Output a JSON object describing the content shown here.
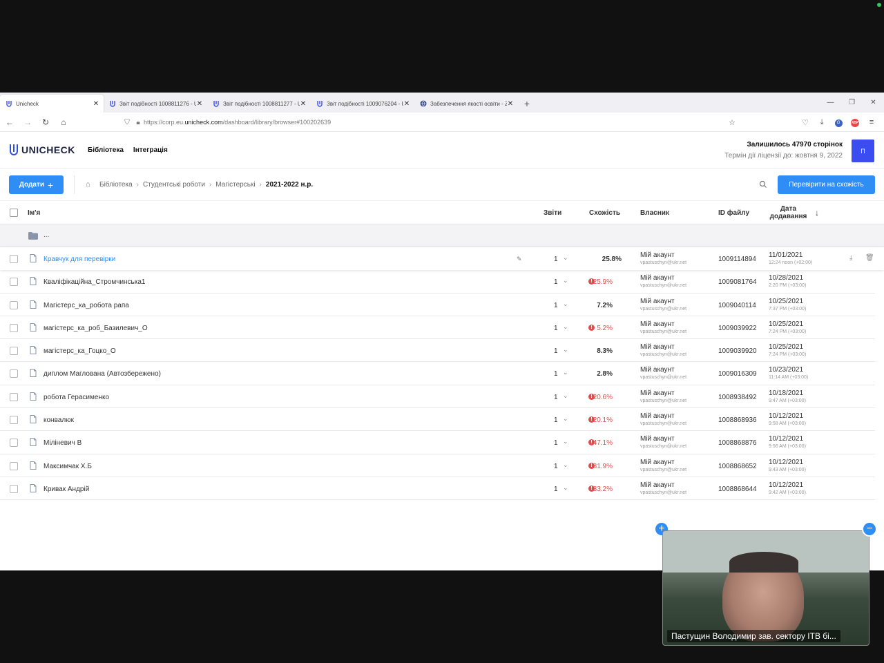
{
  "browser": {
    "tabs": [
      {
        "label": "Unicheck",
        "active": true
      },
      {
        "label": "Звіт подібності 1008811276 - Ur",
        "active": false
      },
      {
        "label": "Звіт подібності 1008811277 - Ur",
        "active": false
      },
      {
        "label": "Звіт подібності 1009076204 - Ur",
        "active": false
      },
      {
        "label": "Забезпечення якості освіти - Z",
        "active": false
      }
    ],
    "url_prefix": "https://corp.eu.",
    "url_domain": "unicheck.com",
    "url_path": "/dashboard/library/browser#100202639"
  },
  "header": {
    "logo_text": "UNICHECK",
    "nav": [
      "Бібліотека",
      "Інтеграція"
    ],
    "pages_left": "Залишилось 47970 сторінок",
    "license": "Термін дії ліцензії до: жовтня 9, 2022",
    "avatar_letter": "П"
  },
  "toolbar": {
    "add_label": "Додати",
    "breadcrumbs": [
      "Бібліотека",
      "Студентські роботи",
      "Магістерські"
    ],
    "current": "2021-2022 н.р.",
    "check_label": "Перевірити на схожість"
  },
  "table": {
    "columns": {
      "name": "Ім'я",
      "reports": "Звіти",
      "similarity": "Схожість",
      "owner": "Власник",
      "file_id": "ID файлу",
      "date_line1": "Дата",
      "date_line2": "додавання"
    },
    "folder": "...",
    "rows": [
      {
        "name": "Кравчук для перевірки",
        "reports": "1",
        "similarity": "25.8%",
        "warn": false,
        "owner": "Мій акаунт",
        "email": "vpastuschyn@ukr.net",
        "file_id": "1009114894",
        "date": "11/01/2021",
        "time": "12:24 noon (+02:00)"
      },
      {
        "name": "Кваліфікаційна_Стромчинська1",
        "reports": "1",
        "similarity": "25.9%",
        "warn": true,
        "owner": "Мій акаунт",
        "email": "vpastuschyn@ukr.net",
        "file_id": "1009081764",
        "date": "10/28/2021",
        "time": "2:20 PM (+03:00)"
      },
      {
        "name": "Магістерс_ка_робота рапа",
        "reports": "1",
        "similarity": "7.2%",
        "warn": false,
        "owner": "Мій акаунт",
        "email": "vpastuschyn@ukr.net",
        "file_id": "1009040114",
        "date": "10/25/2021",
        "time": "7:37 PM (+03:00)"
      },
      {
        "name": "магістерс_ка_роб_Базилевич_О",
        "reports": "1",
        "similarity": "5.2%",
        "warn": true,
        "owner": "Мій акаунт",
        "email": "vpastuschyn@ukr.net",
        "file_id": "1009039922",
        "date": "10/25/2021",
        "time": "7:24 PM (+03:00)"
      },
      {
        "name": "магістерс_ка_Гоцко_О",
        "reports": "1",
        "similarity": "8.3%",
        "warn": false,
        "owner": "Мій акаунт",
        "email": "vpastuschyn@ukr.net",
        "file_id": "1009039920",
        "date": "10/25/2021",
        "time": "7:24 PM (+03:00)"
      },
      {
        "name": "диплом Маглована (Автозбережено)",
        "reports": "1",
        "similarity": "2.8%",
        "warn": false,
        "owner": "Мій акаунт",
        "email": "vpastuschyn@ukr.net",
        "file_id": "1009016309",
        "date": "10/23/2021",
        "time": "11:14 AM (+03:00)"
      },
      {
        "name": "робота Герасименко",
        "reports": "1",
        "similarity": "20.6%",
        "warn": true,
        "owner": "Мій акаунт",
        "email": "vpastuschyn@ukr.net",
        "file_id": "1008938492",
        "date": "10/18/2021",
        "time": "9:47 AM (+03:00)"
      },
      {
        "name": "конвалюк",
        "reports": "1",
        "similarity": "20.1%",
        "warn": true,
        "owner": "Мій акаунт",
        "email": "vpastuschyn@ukr.net",
        "file_id": "1008868936",
        "date": "10/12/2021",
        "time": "9:58 AM (+03:00)"
      },
      {
        "name": "Міліневич В",
        "reports": "1",
        "similarity": "47.1%",
        "warn": true,
        "owner": "Мій акаунт",
        "email": "vpastuschyn@ukr.net",
        "file_id": "1008868876",
        "date": "10/12/2021",
        "time": "9:56 AM (+03:00)"
      },
      {
        "name": "Максимчак Х.Б",
        "reports": "1",
        "similarity": "81.9%",
        "warn": true,
        "owner": "Мій акаунт",
        "email": "vpastuschyn@ukr.net",
        "file_id": "1008868652",
        "date": "10/12/2021",
        "time": "9:43 AM (+03:00)"
      },
      {
        "name": "Кривак Андрій",
        "reports": "1",
        "similarity": "33.2%",
        "warn": true,
        "owner": "Мій акаунт",
        "email": "vpastuschyn@ukr.net",
        "file_id": "1008868644",
        "date": "10/12/2021",
        "time": "9:42 AM (+03:00)"
      }
    ]
  },
  "video": {
    "caption": "Пастущин Володимир зав. сектору ІТВ бі..."
  },
  "colors": {
    "accent": "#2f8ef5",
    "warning": "#e34b4b",
    "avatar": "#3b4cf0"
  }
}
